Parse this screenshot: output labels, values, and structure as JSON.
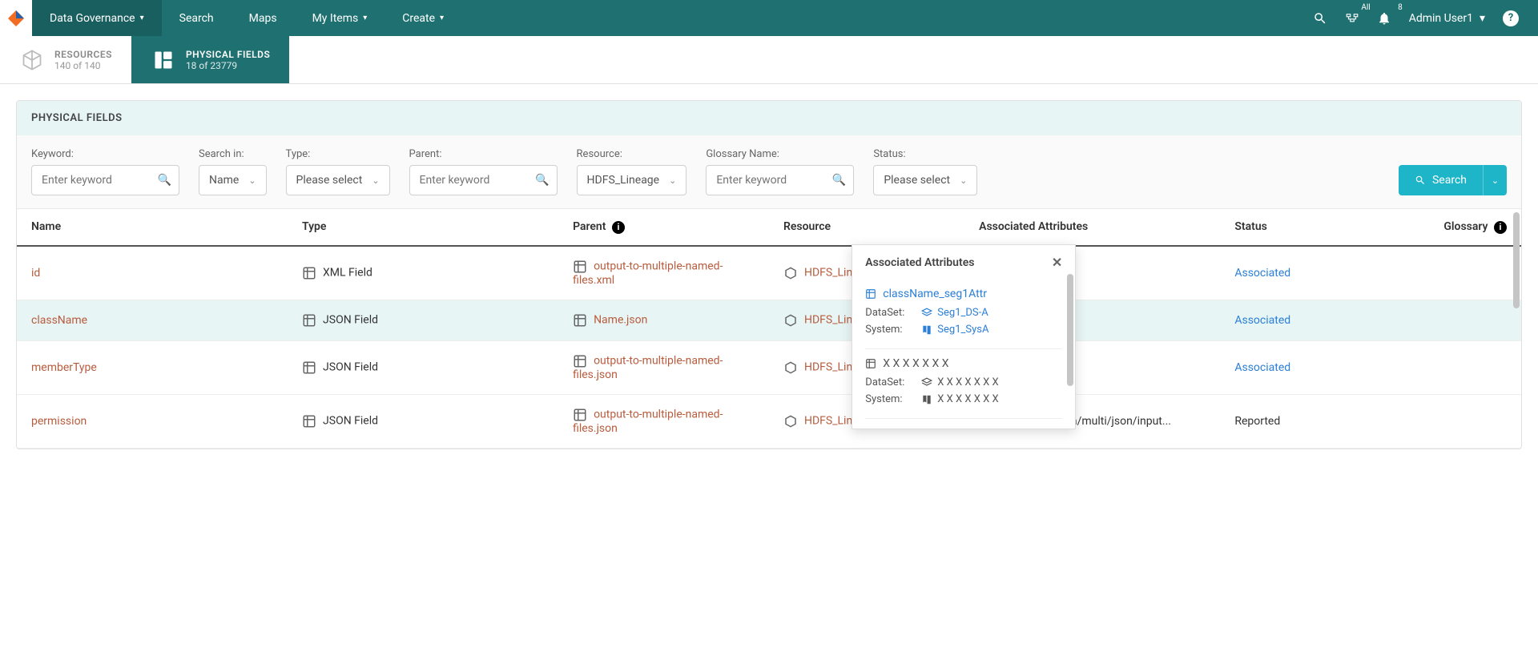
{
  "topnav": {
    "items": [
      {
        "label": "Data Governance",
        "dropdown": true,
        "active": true
      },
      {
        "label": "Search",
        "dropdown": false
      },
      {
        "label": "Maps",
        "dropdown": false
      },
      {
        "label": "My Items",
        "dropdown": true
      },
      {
        "label": "Create",
        "dropdown": true
      }
    ],
    "badge_all": "All",
    "badge_notif": "8",
    "user": "Admin User1"
  },
  "tabs": {
    "resources": {
      "title": "RESOURCES",
      "sub": "140 of 140"
    },
    "physical": {
      "title": "PHYSICAL FIELDS",
      "sub": "18 of 23779"
    }
  },
  "panel": {
    "title": "PHYSICAL FIELDS"
  },
  "filters": {
    "keyword_label": "Keyword:",
    "keyword_placeholder": "Enter keyword",
    "searchin_label": "Search in:",
    "searchin_value": "Name",
    "type_label": "Type:",
    "type_value": "Please select",
    "parent_label": "Parent:",
    "parent_placeholder": "Enter keyword",
    "resource_label": "Resource:",
    "resource_value": "HDFS_Lineage",
    "glossary_label": "Glossary Name:",
    "glossary_placeholder": "Enter keyword",
    "status_label": "Status:",
    "status_value": "Please select",
    "search_btn": "Search"
  },
  "columns": {
    "name": "Name",
    "type": "Type",
    "parent": "Parent",
    "resource": "Resource",
    "assoc": "Associated Attributes",
    "status": "Status",
    "glossary": "Glossary"
  },
  "rows": [
    {
      "name": "id",
      "type": "XML Field",
      "parent": "output-to-multiple-named-files.xml",
      "resource": "HDFS_Lineage",
      "status": "Associated",
      "status_link": true
    },
    {
      "name": "className",
      "type": "JSON Field",
      "parent": "Name.json",
      "resource": "HDFS_Lineage",
      "status": "Associated",
      "status_link": true,
      "highlight": true
    },
    {
      "name": "memberType",
      "type": "JSON Field",
      "parent": "output-to-multiple-named-files.json",
      "resource": "HDFS_Lineage",
      "status": "Associated",
      "status_link": true
    },
    {
      "name": "permission",
      "type": "JSON Field",
      "parent": "output-to-multiple-named-files.json",
      "resource": "HDFS_Lineage",
      "assoc_txt": "Hdfs/user/cloudera/multi/json/input...",
      "status": "Reported",
      "status_link": false
    }
  ],
  "popover": {
    "title": "Associated Attributes",
    "items": [
      {
        "name": "className_seg1Attr",
        "dataset": "Seg1_DS-A",
        "system": "Seg1_SysA",
        "linked": true
      },
      {
        "name": "X X X X X X X",
        "dataset": "X X X X X X X",
        "system": "X X X X X X X",
        "linked": false
      }
    ],
    "lbl_dataset": "DataSet:",
    "lbl_system": "System:"
  }
}
